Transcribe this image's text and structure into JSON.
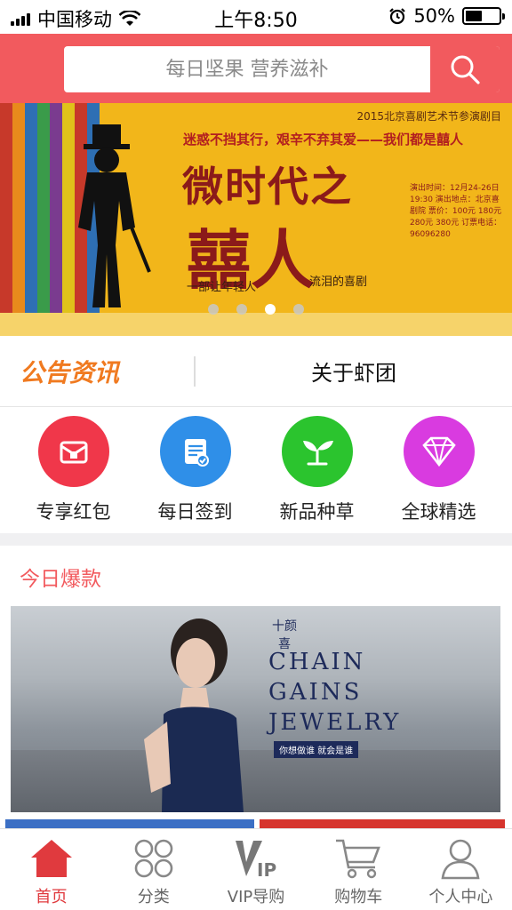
{
  "status_bar": {
    "carrier": "中国移动",
    "time": "上午8:50",
    "battery": "50%",
    "battery_level": 0.5
  },
  "search": {
    "placeholder": "每日坚果 营养滋补"
  },
  "banner": {
    "meta": "2015北京喜剧艺术节参演剧目",
    "slogan": "迷惑不挡其行，艰辛不弃其爱——我们都是囍人",
    "title_line1": "微时代之",
    "title_line2": "囍人",
    "tagline_left": "一部让年轻人",
    "tagline_right": "流泪的喜剧",
    "info": "演出时间：12月24-26日 19:30 演出地点：北京喜剧院 票价：100元 180元 280元 380元 订票电话：96096280",
    "slides": 4,
    "active_slide": 3
  },
  "notice": {
    "brand": "公告资讯",
    "about": "关于虾团"
  },
  "quick_entries": [
    {
      "label": "专享红包",
      "icon": "red-envelope-icon",
      "color": "#f0374a"
    },
    {
      "label": "每日签到",
      "icon": "calendar-check-icon",
      "color": "#2f8fe8"
    },
    {
      "label": "新品种草",
      "icon": "sprout-icon",
      "color": "#2bc42e"
    },
    {
      "label": "全球精选",
      "icon": "diamond-icon",
      "color": "#d93be0"
    }
  ],
  "section": {
    "title": "今日爆款"
  },
  "promo": {
    "logo": "十颜喜",
    "lines": [
      "CHAIN",
      "GAINS",
      "JEWELRY"
    ],
    "subtitle": "你想做谁 就会是谁"
  },
  "tabbar": [
    {
      "label": "首页",
      "icon": "home-icon",
      "active": true
    },
    {
      "label": "分类",
      "icon": "category-icon",
      "active": false
    },
    {
      "label": "VIP导购",
      "icon": "vip-icon",
      "active": false
    },
    {
      "label": "购物车",
      "icon": "cart-icon",
      "active": false
    },
    {
      "label": "个人中心",
      "icon": "user-icon",
      "active": false
    }
  ],
  "colors": {
    "primary": "#f25a5e",
    "accent_orange": "#f07a20",
    "banner_yellow": "#f2b61a"
  }
}
